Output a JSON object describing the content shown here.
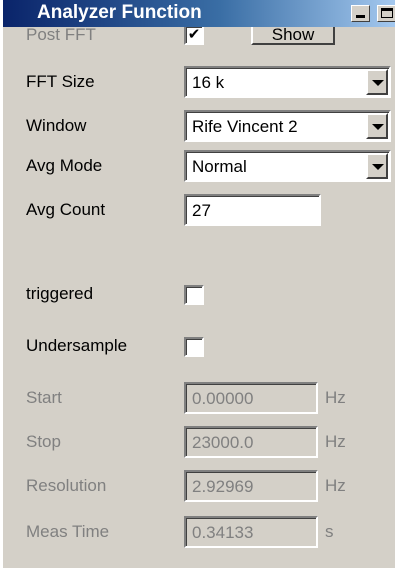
{
  "window": {
    "title": "Analyzer Function"
  },
  "post_fft": {
    "label": "Post FFT",
    "checked": true,
    "check_glyph": "✔",
    "show_label": "Show"
  },
  "fft_size": {
    "label": "FFT Size",
    "value": "16 k"
  },
  "window_fn": {
    "label": "Window",
    "value": "Rife Vincent 2"
  },
  "avg_mode": {
    "label": "Avg Mode",
    "value": "Normal"
  },
  "avg_count": {
    "label": "Avg Count",
    "value": "27"
  },
  "triggered": {
    "label": "triggered",
    "checked": false
  },
  "undersample": {
    "label": "Undersample",
    "checked": false
  },
  "start": {
    "label": "Start",
    "value": "0.00000",
    "unit": "Hz"
  },
  "stop": {
    "label": "Stop",
    "value": "23000.0",
    "unit": "Hz"
  },
  "resolution": {
    "label": "Resolution",
    "value": "2.92969",
    "unit": "Hz"
  },
  "meas_time": {
    "label": "Meas Time",
    "value": "0.34133",
    "unit": "s"
  }
}
